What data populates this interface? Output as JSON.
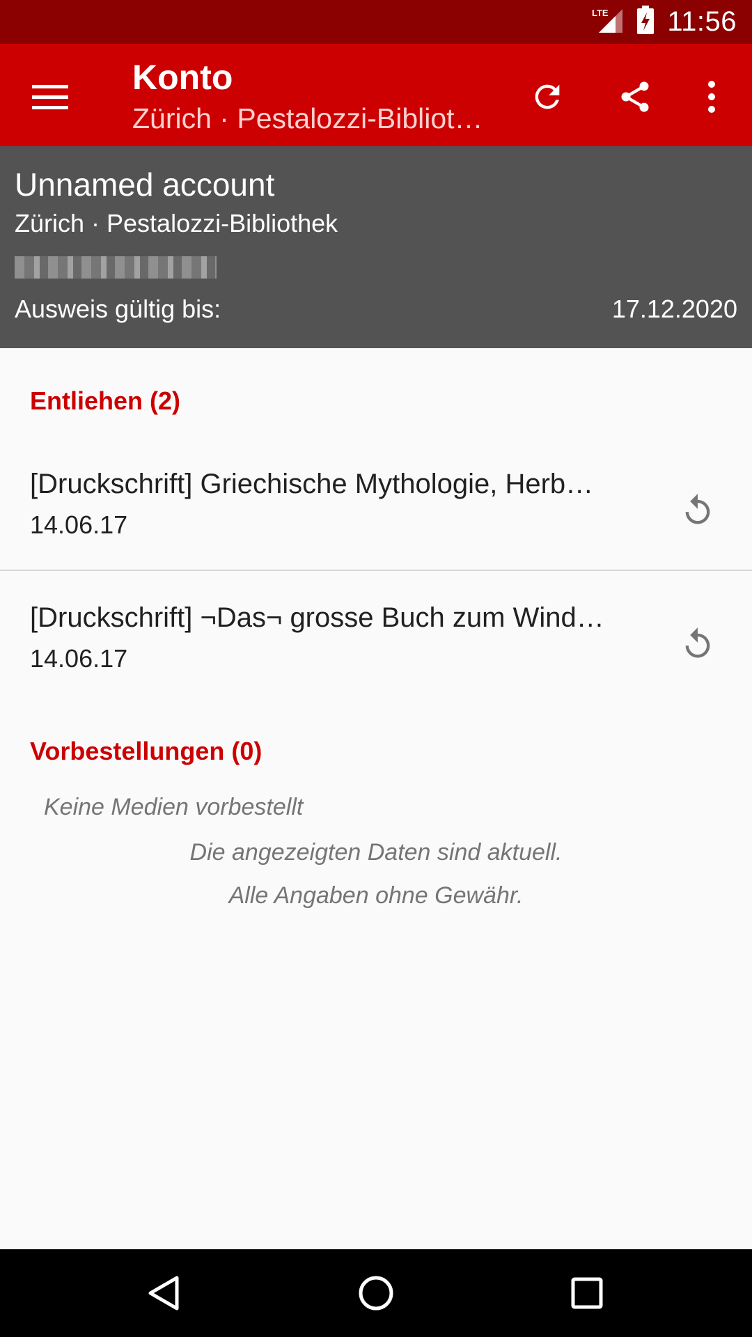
{
  "status_bar": {
    "time": "11:56",
    "network": "LTE"
  },
  "toolbar": {
    "title": "Konto",
    "subtitle": "Zürich · Pestalozzi-Bibliot…",
    "icons": [
      "menu-icon",
      "refresh-icon",
      "share-icon",
      "more-vert-icon"
    ]
  },
  "account": {
    "name": "Unnamed account",
    "library": "Zürich · Pestalozzi-Bibliothek",
    "valid_label": "Ausweis gültig bis:",
    "valid_date": "17.12.2020"
  },
  "lent": {
    "heading": "Entliehen (2)",
    "items": [
      {
        "title": "[Druckschrift] Griechische Mythologie, Herb…",
        "date": "14.06.17"
      },
      {
        "title": "[Druckschrift] ¬Das¬ grosse Buch zum Wind…",
        "date": "14.06.17"
      }
    ]
  },
  "reservations": {
    "heading": "Vorbestellungen (0)",
    "empty": "Keine Medien vorbestellt"
  },
  "footer": {
    "line1": "Die angezeigten Daten sind aktuell.",
    "line2": "Alle Angaben ohne Gewähr."
  },
  "colors": {
    "status_bar": "#8b0000",
    "toolbar": "#cc0000",
    "account_header": "#535353",
    "accent": "#cc0000"
  }
}
